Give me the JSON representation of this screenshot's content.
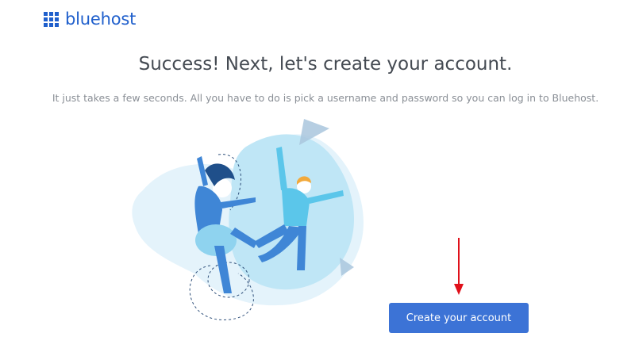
{
  "brand": {
    "name": "bluehost",
    "color": "#1f5fcc"
  },
  "main": {
    "headline": "Success! Next, let's create your account.",
    "subtext": "It just takes a few seconds. All you have to do is pick a username and password so you can log in to Bluehost.",
    "cta_label": "Create your account"
  },
  "colors": {
    "accent": "#3c73d6",
    "arrow": "#e0101a"
  },
  "icons": {
    "logo": "grid-logo-icon",
    "illustration": "celebrating-people-illustration",
    "pointer": "red-arrow-down-icon"
  }
}
